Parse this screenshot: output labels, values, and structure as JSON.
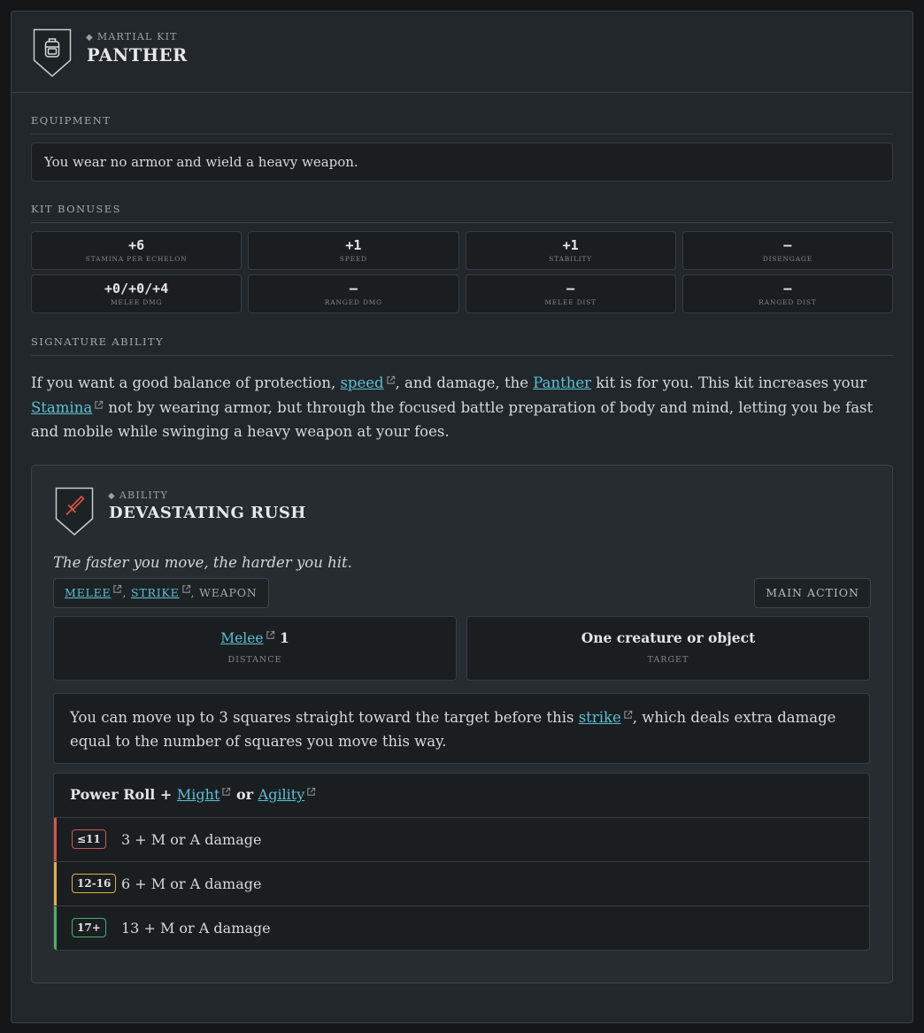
{
  "header": {
    "eyebrow": "MARTIAL KIT",
    "title": "PANTHER",
    "icon": "backpack-icon"
  },
  "equipment": {
    "label": "EQUIPMENT",
    "text": "You wear no armor and wield a heavy weapon."
  },
  "kit_bonuses": {
    "label": "KIT BONUSES",
    "items": [
      {
        "value": "+6",
        "label": "STAMINA PER ECHELON"
      },
      {
        "value": "+1",
        "label": "SPEED"
      },
      {
        "value": "+1",
        "label": "STABILITY"
      },
      {
        "value": "–",
        "label": "DISENGAGE"
      },
      {
        "value": "+0/+0/+4",
        "label": "MELEE DMG"
      },
      {
        "value": "–",
        "label": "RANGED DMG"
      },
      {
        "value": "–",
        "label": "MELEE DIST"
      },
      {
        "value": "–",
        "label": "RANGED DIST"
      }
    ]
  },
  "signature": {
    "label": "SIGNATURE ABILITY",
    "desc_1": "If you want a good balance of protection, ",
    "link_speed": "speed",
    "desc_2": ", and damage, the ",
    "link_panther": "Panther",
    "desc_3": " kit is for you. This kit increases your ",
    "link_stamina": "Stamina",
    "desc_4": " not by wearing armor, but through the focused battle preparation of body and mind, letting you be fast and mobile while swinging a heavy weapon at your foes."
  },
  "ability": {
    "eyebrow": "ABILITY",
    "title": "DEVASTATING RUSH",
    "icon": "sword-icon",
    "flavor": "The faster you move, the harder you hit.",
    "keyword_melee": "MELEE",
    "keyword_strike": "STRIKE",
    "keyword_sep": ", ",
    "keyword_weapon": "WEAPON",
    "action": "MAIN ACTION",
    "distance_link": "Melee",
    "distance_value": "1",
    "distance_label": "DISTANCE",
    "target_value": "One creature or object",
    "target_label": "TARGET",
    "effect_1": "You can move up to 3 squares straight toward the target before this ",
    "effect_link": "strike",
    "effect_2": ", which deals extra damage equal to the number of squares you move this way.",
    "power_roll": {
      "prefix": "Power Roll + ",
      "stat1": "Might",
      "or": " or ",
      "stat2": "Agility",
      "tiers": [
        {
          "badge": "≤11",
          "text": "3 + M or A damage",
          "color": "#d9534f"
        },
        {
          "badge": "12-16",
          "text": "6 + M or A damage",
          "color": "#e0b23a"
        },
        {
          "badge": "17+",
          "text": "13 + M or A damage",
          "color": "#4caf6a"
        }
      ]
    }
  },
  "colors": {
    "link": "#5bc0d4",
    "sword": "#e0533f"
  }
}
